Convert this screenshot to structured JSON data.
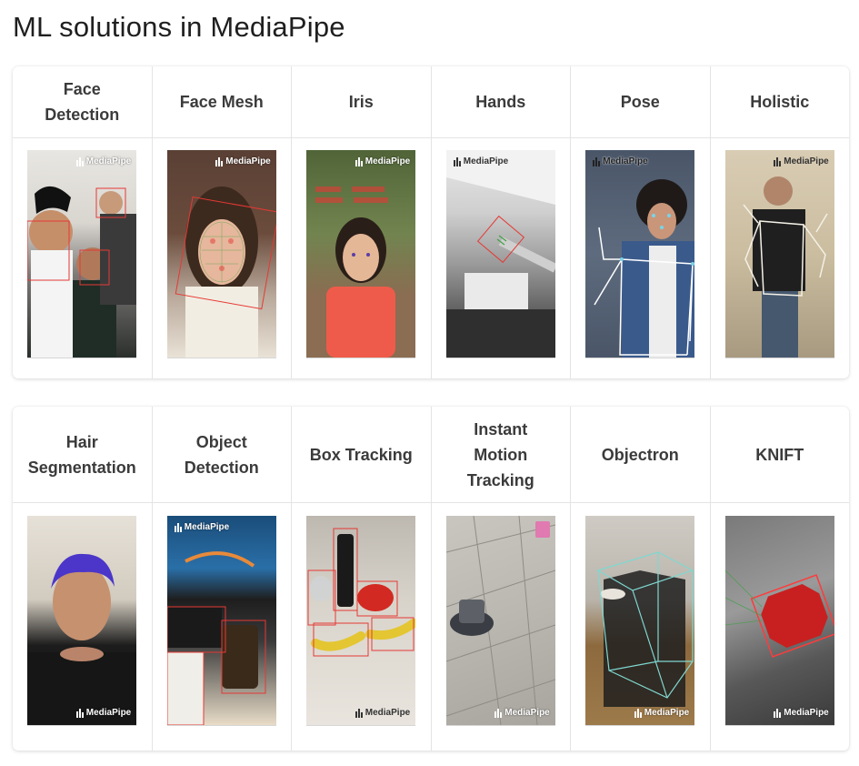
{
  "page": {
    "title": "ML solutions in MediaPipe"
  },
  "logo_text": "MediaPipe",
  "row1": [
    {
      "label": "Face\nDetection",
      "image": "face-detection-preview"
    },
    {
      "label": "Face Mesh",
      "image": "face-mesh-preview"
    },
    {
      "label": "Iris",
      "image": "iris-preview"
    },
    {
      "label": "Hands",
      "image": "hands-preview"
    },
    {
      "label": "Pose",
      "image": "pose-preview"
    },
    {
      "label": "Holistic",
      "image": "holistic-preview"
    }
  ],
  "row2": [
    {
      "label": "Hair\nSegmentation",
      "image": "hair-segmentation-preview"
    },
    {
      "label": "Object\nDetection",
      "image": "object-detection-preview"
    },
    {
      "label": "Box Tracking",
      "image": "box-tracking-preview"
    },
    {
      "label": "Instant\nMotion\nTracking",
      "image": "instant-motion-tracking-preview"
    },
    {
      "label": "Objectron",
      "image": "objectron-preview"
    },
    {
      "label": "KNIFT",
      "image": "knift-preview"
    }
  ],
  "colors": {
    "detection_box": "#e53935",
    "landmark_green": "#43a047",
    "pose_line": "#ffffff",
    "objectron_box": "#7fd8d0"
  }
}
